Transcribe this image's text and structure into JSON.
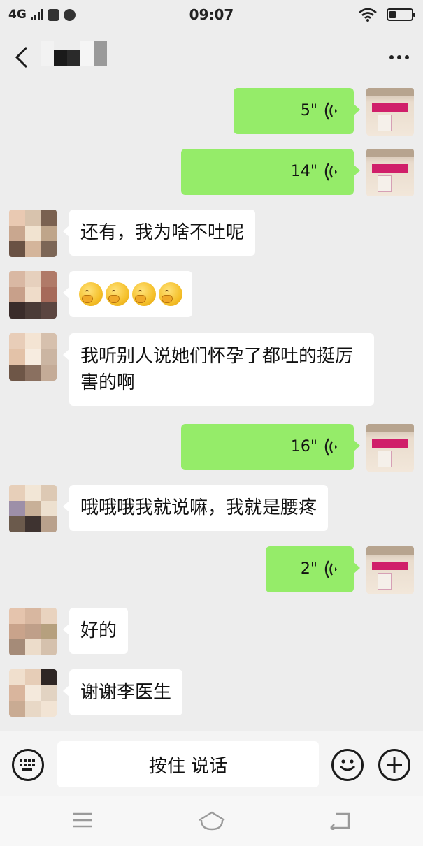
{
  "status_bar": {
    "network": "4G",
    "time": "09:07",
    "battery_level": 0.3
  },
  "header": {
    "back_icon": "chevron-left-icon",
    "contact_name_redacted": true,
    "more_icon": "more-dots-icon"
  },
  "messages": [
    {
      "direction": "out",
      "type": "voice",
      "duration": "5\""
    },
    {
      "direction": "out",
      "type": "voice",
      "duration": "14\""
    },
    {
      "direction": "in",
      "type": "text",
      "text": "还有，我为啥不吐呢"
    },
    {
      "direction": "in",
      "type": "emoji",
      "emoji_count": 4,
      "emoji_name": "thinking-face"
    },
    {
      "direction": "in",
      "type": "text",
      "text": "我听别人说她们怀孕了都吐的挺厉害的啊"
    },
    {
      "direction": "out",
      "type": "voice",
      "duration": "16\""
    },
    {
      "direction": "in",
      "type": "text",
      "text": "哦哦哦我就说嘛，我就是腰疼"
    },
    {
      "direction": "out",
      "type": "voice",
      "duration": "2\""
    },
    {
      "direction": "in",
      "type": "text",
      "text": "好的"
    },
    {
      "direction": "in",
      "type": "text",
      "text": "谢谢李医生"
    }
  ],
  "input_bar": {
    "hold_to_talk": "按住 说话",
    "keyboard_icon": "keyboard-icon",
    "emoji_icon": "smiley-icon",
    "plus_icon": "plus-icon"
  },
  "nav_bar": {
    "menu_icon": "menu-icon",
    "home_icon": "home-icon",
    "back_icon": "back-icon"
  },
  "colors": {
    "outgoing_bubble": "#95ec69",
    "incoming_bubble": "#ffffff",
    "chat_background": "#ededed"
  }
}
